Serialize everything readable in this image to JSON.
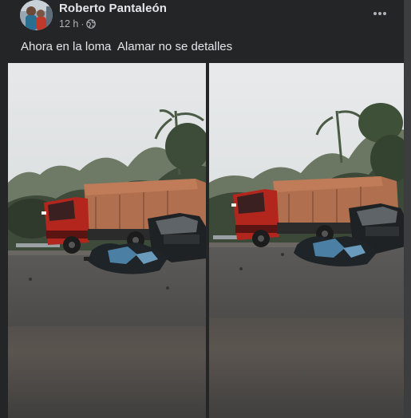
{
  "post": {
    "author": "Roberto Pantaleón",
    "time": "12 h",
    "separator": "·",
    "audience_icon": "globe-icon",
    "more_icon": "more-horizontal-icon",
    "caption": "Ahora en la loma  Alamar no se detalles",
    "photos": [
      {
        "id": "left",
        "alt": "Accident scene photo 1"
      },
      {
        "id": "right",
        "alt": "Accident scene photo 2"
      }
    ]
  },
  "colors": {
    "background": "#242526",
    "text_primary": "#e4e6eb",
    "text_secondary": "#b0b3b8"
  }
}
